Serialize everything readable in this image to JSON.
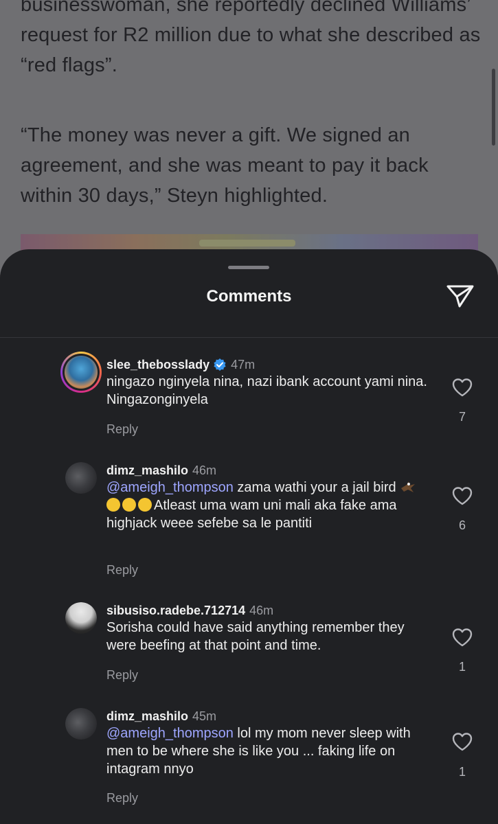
{
  "article": {
    "paragraph1": "businesswoman, she reportedly declined Williams’ request for R2 million due to what she described as “red flags”.",
    "paragraph2": "“The money was never a gift. We signed an agreement, and she was meant to pay it back within 30 days,” Steyn highlighted."
  },
  "sheet": {
    "title": "Comments",
    "share_icon": "paper-plane-icon"
  },
  "comments": [
    {
      "username": "slee_thebosslady",
      "verified": true,
      "time": "47m",
      "text": "ningazo nginyela nina, nazi ibank account yami nina. Ningazonginyela",
      "reply_label": "Reply",
      "likes": "7"
    },
    {
      "username": "dimz_mashilo",
      "verified": false,
      "time": "46m",
      "mention": "@ameigh_thompson",
      "text_part1": " zama wathi your a jail bird ",
      "text_part2": "Atleast uma wam uni mali aka fake ama highjack weee sefebe sa le pantiti",
      "reply_label": "Reply",
      "likes": "6"
    },
    {
      "username": "sibusiso.radebe.712714",
      "verified": false,
      "time": "46m",
      "text": "Sorisha could have said anything remember they were beefing at that point and time.",
      "reply_label": "Reply",
      "likes": "1"
    },
    {
      "username": "dimz_mashilo",
      "verified": false,
      "time": "45m",
      "mention": "@ameigh_thompson",
      "text": " lol my mom never sleep with men to be where she is like you ... faking life on intagram nnyo",
      "reply_label": "Reply",
      "likes": "1"
    }
  ],
  "colors": {
    "sheet_bg": "#202124",
    "mention": "#9ea6ff",
    "verified": "#3897f0"
  }
}
